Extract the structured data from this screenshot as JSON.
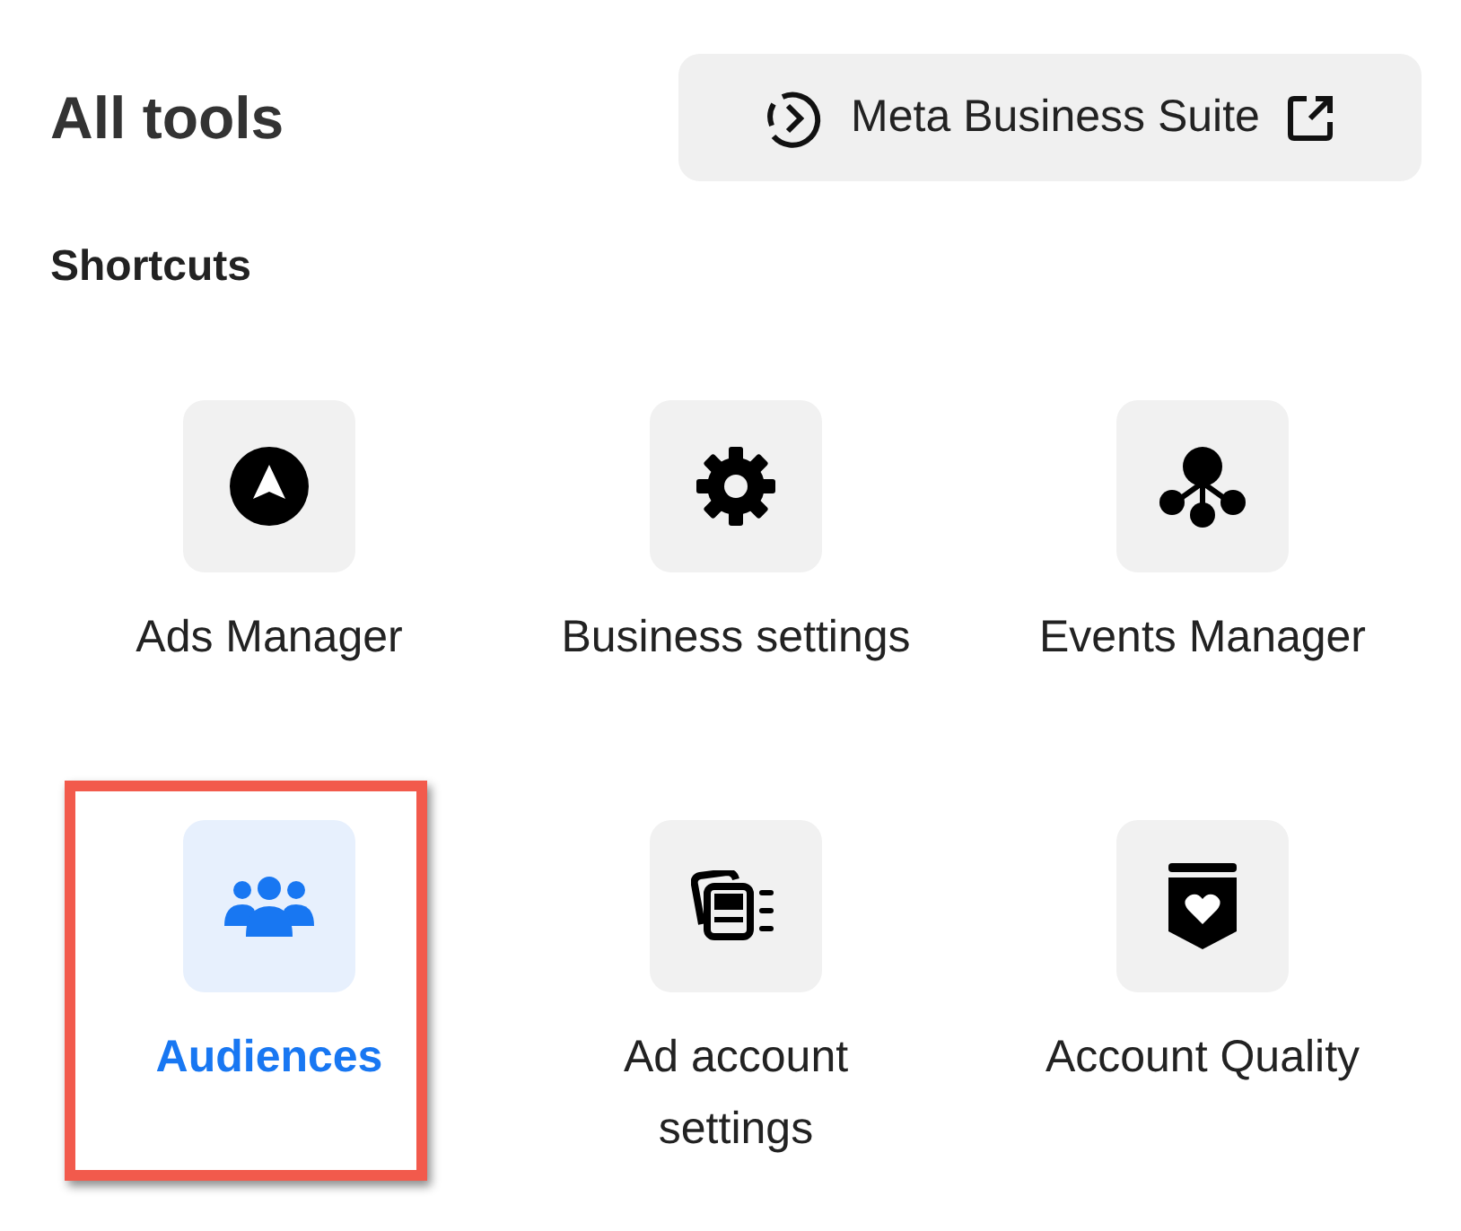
{
  "header": {
    "title": "All tools",
    "button": {
      "label": "Meta Business Suite"
    }
  },
  "section": {
    "title": "Shortcuts"
  },
  "shortcuts": [
    {
      "kind": "ads",
      "label": "Ads Manager",
      "selected": false,
      "highlighted": false
    },
    {
      "kind": "gear",
      "label": "Business settings",
      "selected": false,
      "highlighted": false
    },
    {
      "kind": "events",
      "label": "Events Manager",
      "selected": false,
      "highlighted": false
    },
    {
      "kind": "people",
      "label": "Audiences",
      "selected": true,
      "highlighted": true
    },
    {
      "kind": "cards",
      "label": "Ad account settings",
      "selected": false,
      "highlighted": false
    },
    {
      "kind": "shield",
      "label": "Account Quality",
      "selected": false,
      "highlighted": false
    }
  ]
}
